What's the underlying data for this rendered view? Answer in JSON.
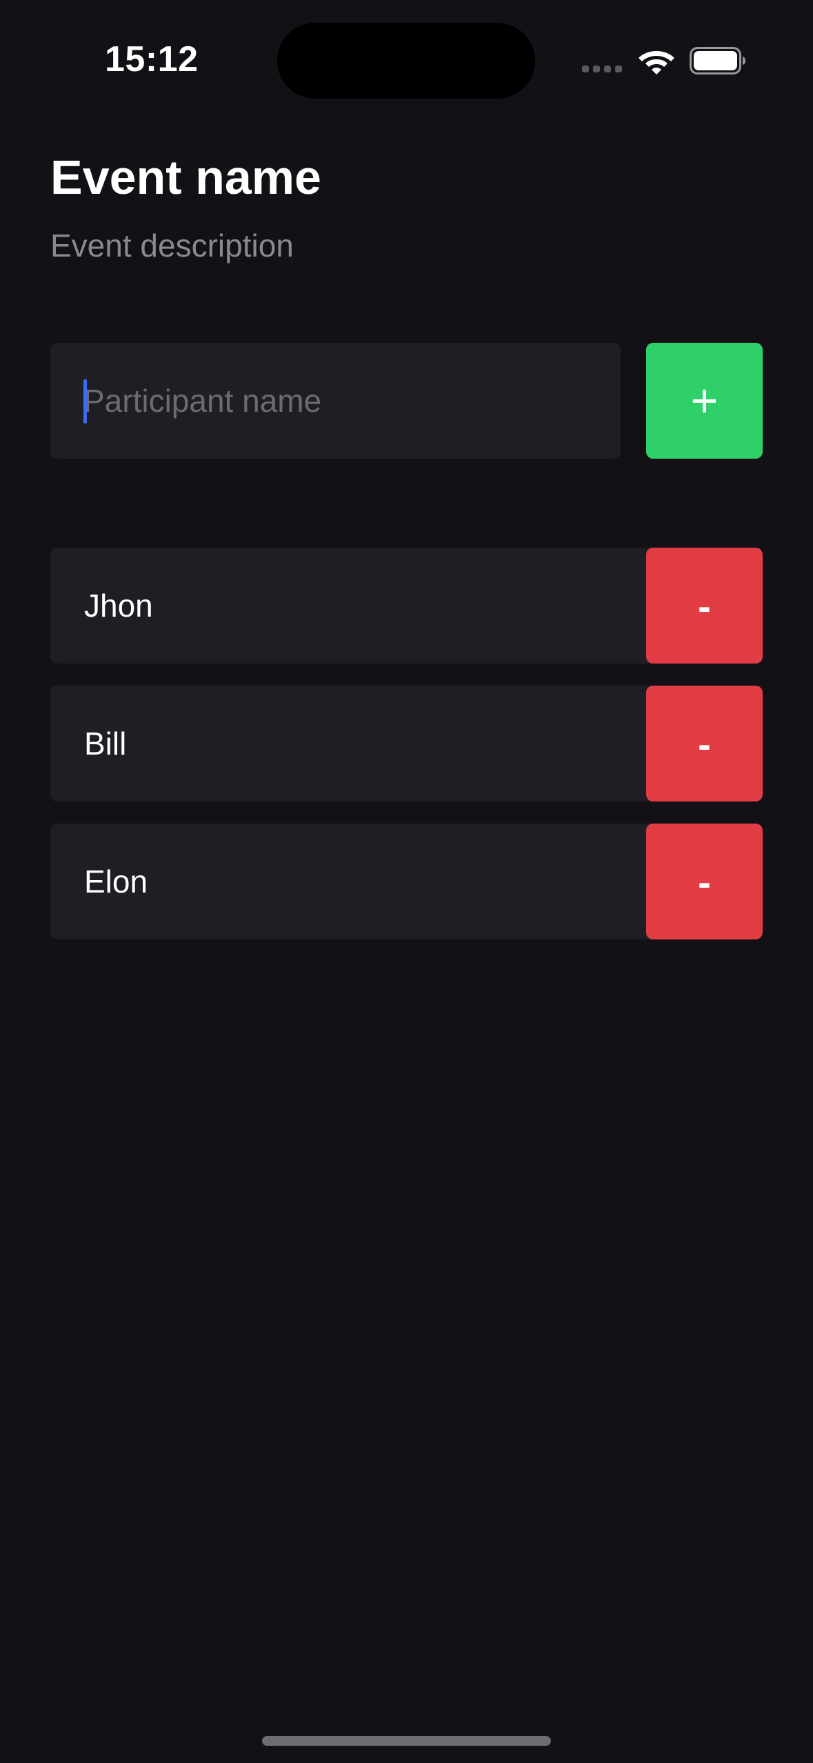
{
  "status_bar": {
    "time": "15:12"
  },
  "event": {
    "title": "Event name",
    "description": "Event description"
  },
  "participant_input": {
    "placeholder": "Participant name",
    "value": ""
  },
  "add_button": {
    "label": "+"
  },
  "participants": [
    {
      "name": "Jhon",
      "remove_label": "-"
    },
    {
      "name": "Bill",
      "remove_label": "-"
    },
    {
      "name": "Elon",
      "remove_label": "-"
    }
  ],
  "colors": {
    "background": "#131016",
    "card": "#1f1e24",
    "add_green": "#2fd06a",
    "remove_red": "#e23d45",
    "caret_blue": "#3a6df0"
  }
}
